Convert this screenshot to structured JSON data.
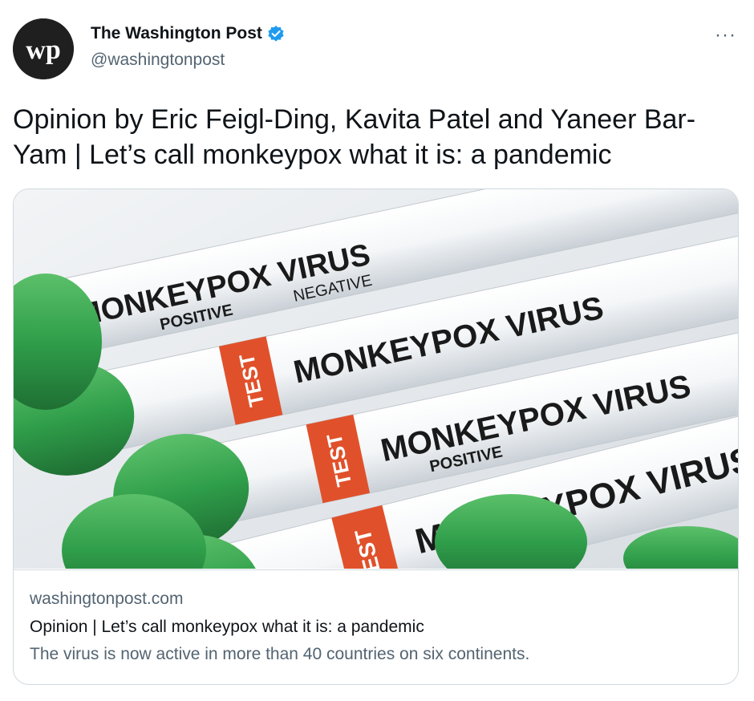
{
  "author": {
    "name": "The Washington Post",
    "handle": "@washingtonpost",
    "avatar_text": "wp",
    "verified_icon": "verified-badge-icon"
  },
  "menu": {
    "more_icon": "more-icon",
    "more_label": "···"
  },
  "tweet": {
    "text": "Opinion by Eric Feigl-Ding, Kavita Patel and Yaneer Bar-Yam | Let’s call monkeypox what it is: a pandemic"
  },
  "card": {
    "domain": "washingtonpost.com",
    "title": "Opinion | Let’s call monkeypox what it is: a pandemic",
    "description": "The virus is now active in more than 40 countries on six continents.",
    "image": {
      "tube_labels": [
        "MONKEYPOX VIRUS",
        "MONKEYPOX VIRUS",
        "MONKEYPOX VIRUS",
        "MONKEYPOX VIRUS"
      ],
      "tag_label": "TEST",
      "positive_label": "POSITIVE",
      "negative_label": "NEGATIVE"
    }
  },
  "colors": {
    "accent": "#1d9bf0",
    "cap_green": "#2f9e4a",
    "tag_orange": "#e0512b"
  }
}
